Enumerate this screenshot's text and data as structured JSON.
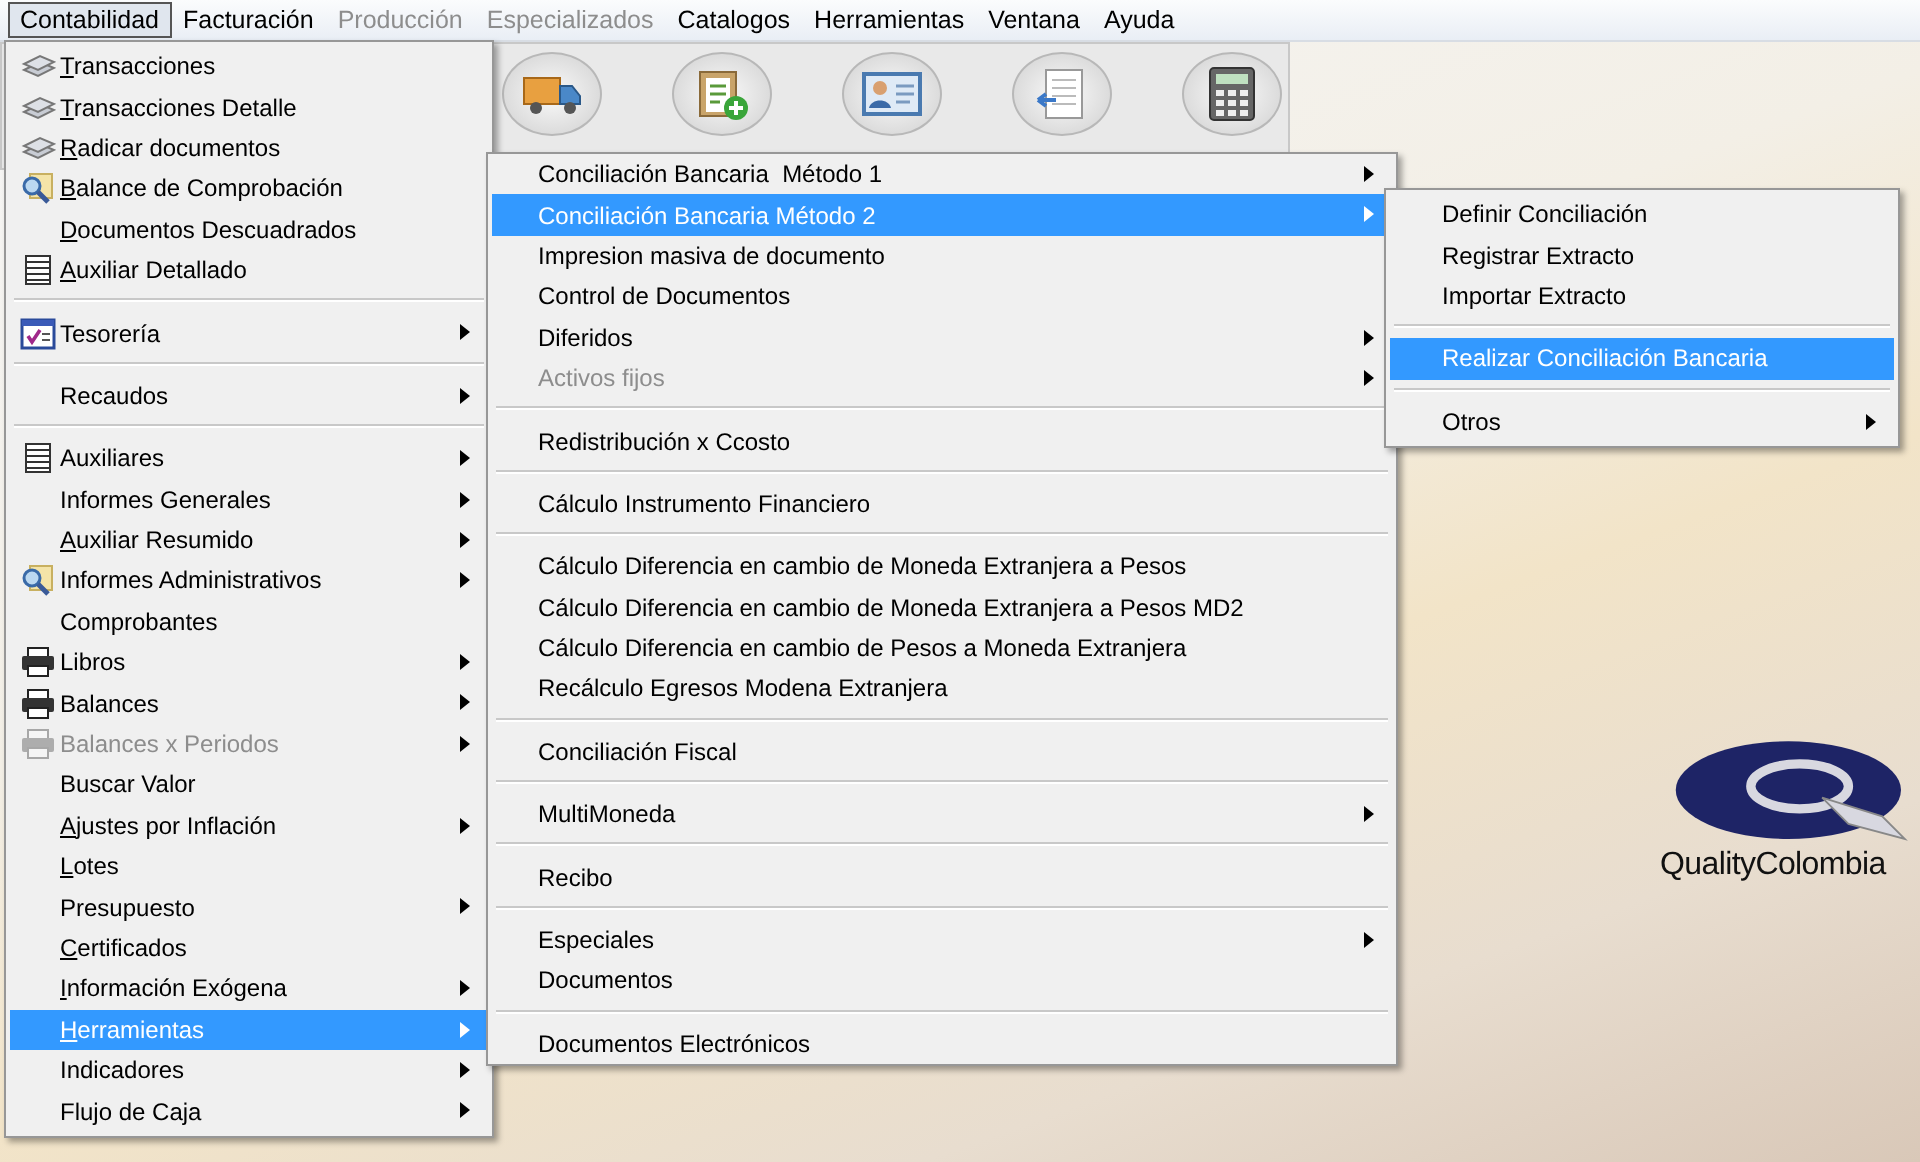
{
  "menubar": [
    {
      "label": "Contabilidad",
      "selected": true,
      "disabled": false
    },
    {
      "label": "Facturación",
      "selected": false,
      "disabled": false
    },
    {
      "label": "Producción",
      "selected": false,
      "disabled": true
    },
    {
      "label": "Especializados",
      "selected": false,
      "disabled": true
    },
    {
      "label": "Catalogos",
      "selected": false,
      "disabled": false
    },
    {
      "label": "Herramientas",
      "selected": false,
      "disabled": false
    },
    {
      "label": "Ventana",
      "selected": false,
      "disabled": false
    },
    {
      "label": "Ayuda",
      "selected": false,
      "disabled": false
    }
  ],
  "toolbar": [
    {
      "kind": "truck"
    },
    {
      "kind": "clipboard"
    },
    {
      "kind": "idcard"
    },
    {
      "kind": "document"
    },
    {
      "kind": "calculator"
    }
  ],
  "logo": {
    "name": "QualityColombia"
  },
  "menus": [
    {
      "sections": [
        [
          {
            "label": "Transacciones",
            "kind": "stack",
            "mnemonic": true,
            "submenu": false,
            "selected": false,
            "disabled": false
          },
          {
            "label": "Transacciones Detalle",
            "kind": "stack",
            "mnemonic": true,
            "submenu": false,
            "selected": false,
            "disabled": false
          },
          {
            "label": "Radicar documentos",
            "kind": "stack",
            "mnemonic": true,
            "submenu": false,
            "selected": false,
            "disabled": false
          },
          {
            "label": "Balance de Comprobación",
            "kind": "magnifier",
            "mnemonic": true,
            "submenu": false,
            "selected": false,
            "disabled": false
          },
          {
            "label": "Documentos Descuadrados",
            "kind": "plain",
            "mnemonic": true,
            "submenu": false,
            "selected": false,
            "disabled": false
          },
          {
            "label": "Auxiliar Detallado",
            "kind": "notebook",
            "mnemonic": true,
            "submenu": false,
            "selected": false,
            "disabled": false
          }
        ],
        [
          {
            "label": "Tesorería",
            "kind": "checklist",
            "mnemonic": false,
            "submenu": true,
            "selected": false,
            "disabled": false
          }
        ],
        [
          {
            "label": "Recaudos",
            "kind": "plain",
            "mnemonic": false,
            "submenu": true,
            "selected": false,
            "disabled": false
          }
        ],
        [
          {
            "label": "Auxiliares",
            "kind": "notebook",
            "mnemonic": false,
            "submenu": true,
            "selected": false,
            "disabled": false
          },
          {
            "label": "Informes Generales",
            "kind": "plain",
            "mnemonic": false,
            "submenu": true,
            "selected": false,
            "disabled": false
          },
          {
            "label": "Auxiliar Resumido",
            "kind": "plain",
            "mnemonic": true,
            "submenu": true,
            "selected": false,
            "disabled": false
          },
          {
            "label": "Informes Administrativos",
            "kind": "magnifier",
            "mnemonic": false,
            "submenu": true,
            "selected": false,
            "disabled": false
          },
          {
            "label": "Comprobantes",
            "kind": "plain",
            "mnemonic": false,
            "submenu": false,
            "selected": false,
            "disabled": false
          },
          {
            "label": "Libros",
            "kind": "printer",
            "mnemonic": false,
            "submenu": true,
            "selected": false,
            "disabled": false
          },
          {
            "label": "Balances",
            "kind": "printer",
            "mnemonic": false,
            "submenu": true,
            "selected": false,
            "disabled": false
          },
          {
            "label": "Balances x Periodos",
            "kind": "printer",
            "mnemonic": false,
            "submenu": true,
            "selected": false,
            "disabled": true
          },
          {
            "label": "Buscar Valor",
            "kind": "plain",
            "mnemonic": false,
            "submenu": false,
            "selected": false,
            "disabled": false
          },
          {
            "label": "Ajustes por Inflación",
            "kind": "plain",
            "mnemonic": true,
            "submenu": true,
            "selected": false,
            "disabled": false
          },
          {
            "label": "Lotes",
            "kind": "plain",
            "mnemonic": true,
            "submenu": false,
            "selected": false,
            "disabled": false
          },
          {
            "label": "Presupuesto",
            "kind": "plain",
            "mnemonic": false,
            "submenu": true,
            "selected": false,
            "disabled": false
          },
          {
            "label": "Certificados",
            "kind": "plain",
            "mnemonic": true,
            "submenu": false,
            "selected": false,
            "disabled": false
          },
          {
            "label": "Información Exógena",
            "kind": "plain",
            "mnemonic": true,
            "submenu": true,
            "selected": false,
            "disabled": false
          },
          {
            "label": "Herramientas",
            "kind": "plain",
            "mnemonic": true,
            "submenu": true,
            "selected": true,
            "disabled": false
          },
          {
            "label": "Indicadores",
            "kind": "plain",
            "mnemonic": false,
            "submenu": true,
            "selected": false,
            "disabled": false
          },
          {
            "label": "Flujo de Caja",
            "kind": "plain",
            "mnemonic": false,
            "submenu": true,
            "selected": false,
            "disabled": false
          }
        ]
      ]
    },
    {
      "sections": [
        [
          {
            "label": "Conciliación Bancaria  Método 1",
            "kind": "plain",
            "mnemonic": false,
            "submenu": true,
            "selected": false,
            "disabled": false
          },
          {
            "label": "Conciliación Bancaria Método 2",
            "kind": "plain",
            "mnemonic": false,
            "submenu": true,
            "selected": true,
            "disabled": false
          },
          {
            "label": "Impresion masiva de documento",
            "kind": "plain",
            "mnemonic": false,
            "submenu": false,
            "selected": false,
            "disabled": false
          },
          {
            "label": "Control de Documentos",
            "kind": "plain",
            "mnemonic": false,
            "submenu": false,
            "selected": false,
            "disabled": false
          },
          {
            "label": "Diferidos",
            "kind": "plain",
            "mnemonic": false,
            "submenu": true,
            "selected": false,
            "disabled": false
          },
          {
            "label": "Activos fijos",
            "kind": "plain",
            "mnemonic": false,
            "submenu": true,
            "selected": false,
            "disabled": true
          }
        ],
        [
          {
            "label": "Redistribución x Ccosto",
            "kind": "plain",
            "mnemonic": false,
            "submenu": false,
            "selected": false,
            "disabled": false
          }
        ],
        [
          {
            "label": "Cálculo Instrumento Financiero",
            "kind": "plain",
            "mnemonic": false,
            "submenu": false,
            "selected": false,
            "disabled": false
          }
        ],
        [
          {
            "label": "Cálculo Diferencia en cambio de Moneda Extranjera a Pesos",
            "kind": "plain",
            "mnemonic": false,
            "submenu": false,
            "selected": false,
            "disabled": false
          },
          {
            "label": "Cálculo Diferencia en cambio de Moneda Extranjera a Pesos MD2",
            "kind": "plain",
            "mnemonic": false,
            "submenu": false,
            "selected": false,
            "disabled": false
          },
          {
            "label": "Cálculo Diferencia en cambio de Pesos a Moneda Extranjera",
            "kind": "plain",
            "mnemonic": false,
            "submenu": false,
            "selected": false,
            "disabled": false
          },
          {
            "label": "Recálculo Egresos Modena Extranjera",
            "kind": "plain",
            "mnemonic": false,
            "submenu": false,
            "selected": false,
            "disabled": false
          }
        ],
        [
          {
            "label": "Conciliación Fiscal",
            "kind": "plain",
            "mnemonic": false,
            "submenu": false,
            "selected": false,
            "disabled": false
          }
        ],
        [
          {
            "label": "MultiMoneda",
            "kind": "plain",
            "mnemonic": false,
            "submenu": true,
            "selected": false,
            "disabled": false
          }
        ],
        [
          {
            "label": "Recibo",
            "kind": "plain",
            "mnemonic": false,
            "submenu": false,
            "selected": false,
            "disabled": false
          }
        ],
        [
          {
            "label": "Especiales",
            "kind": "plain",
            "mnemonic": false,
            "submenu": true,
            "selected": false,
            "disabled": false
          },
          {
            "label": "Documentos",
            "kind": "plain",
            "mnemonic": false,
            "submenu": false,
            "selected": false,
            "disabled": false
          }
        ],
        [
          {
            "label": "Documentos Electrónicos",
            "kind": "plain",
            "mnemonic": false,
            "submenu": false,
            "selected": false,
            "disabled": false
          }
        ]
      ]
    },
    {
      "sections": [
        [
          {
            "label": "Definir Conciliación",
            "kind": "plain",
            "mnemonic": false,
            "submenu": false,
            "selected": false,
            "disabled": false
          },
          {
            "label": "Registrar Extracto",
            "kind": "plain",
            "mnemonic": false,
            "submenu": false,
            "selected": false,
            "disabled": false
          },
          {
            "label": "Importar Extracto",
            "kind": "plain",
            "mnemonic": false,
            "submenu": false,
            "selected": false,
            "disabled": false
          }
        ],
        [
          {
            "label": "Realizar Conciliación Bancaria",
            "kind": "plain",
            "mnemonic": false,
            "submenu": false,
            "selected": true,
            "disabled": false
          }
        ],
        [
          {
            "label": "Otros",
            "kind": "plain",
            "mnemonic": false,
            "submenu": true,
            "selected": false,
            "disabled": false
          }
        ]
      ]
    }
  ]
}
